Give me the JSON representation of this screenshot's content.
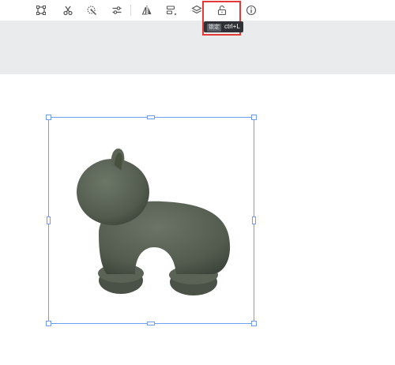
{
  "toolbar": {
    "tools": [
      {
        "id": "crop",
        "icon": "crop-icon"
      },
      {
        "id": "cut",
        "icon": "scissors-icon"
      },
      {
        "id": "magic",
        "icon": "magic-wand-icon"
      },
      {
        "id": "adjust",
        "icon": "sliders-icon"
      },
      {
        "id": "flip",
        "icon": "flip-icon"
      },
      {
        "id": "align",
        "icon": "align-icon"
      },
      {
        "id": "layers",
        "icon": "layers-icon"
      },
      {
        "id": "lock",
        "icon": "unlock-icon"
      },
      {
        "id": "info",
        "icon": "info-icon"
      }
    ]
  },
  "tooltip": {
    "key_badge": "锁定",
    "shortcut": "ctrl+L"
  },
  "colors": {
    "highlight": "#e53935",
    "selection": "#6f9df2",
    "band": "#eaebed",
    "figure": "#535c4f"
  },
  "canvas": {
    "object": "plush-figure"
  }
}
